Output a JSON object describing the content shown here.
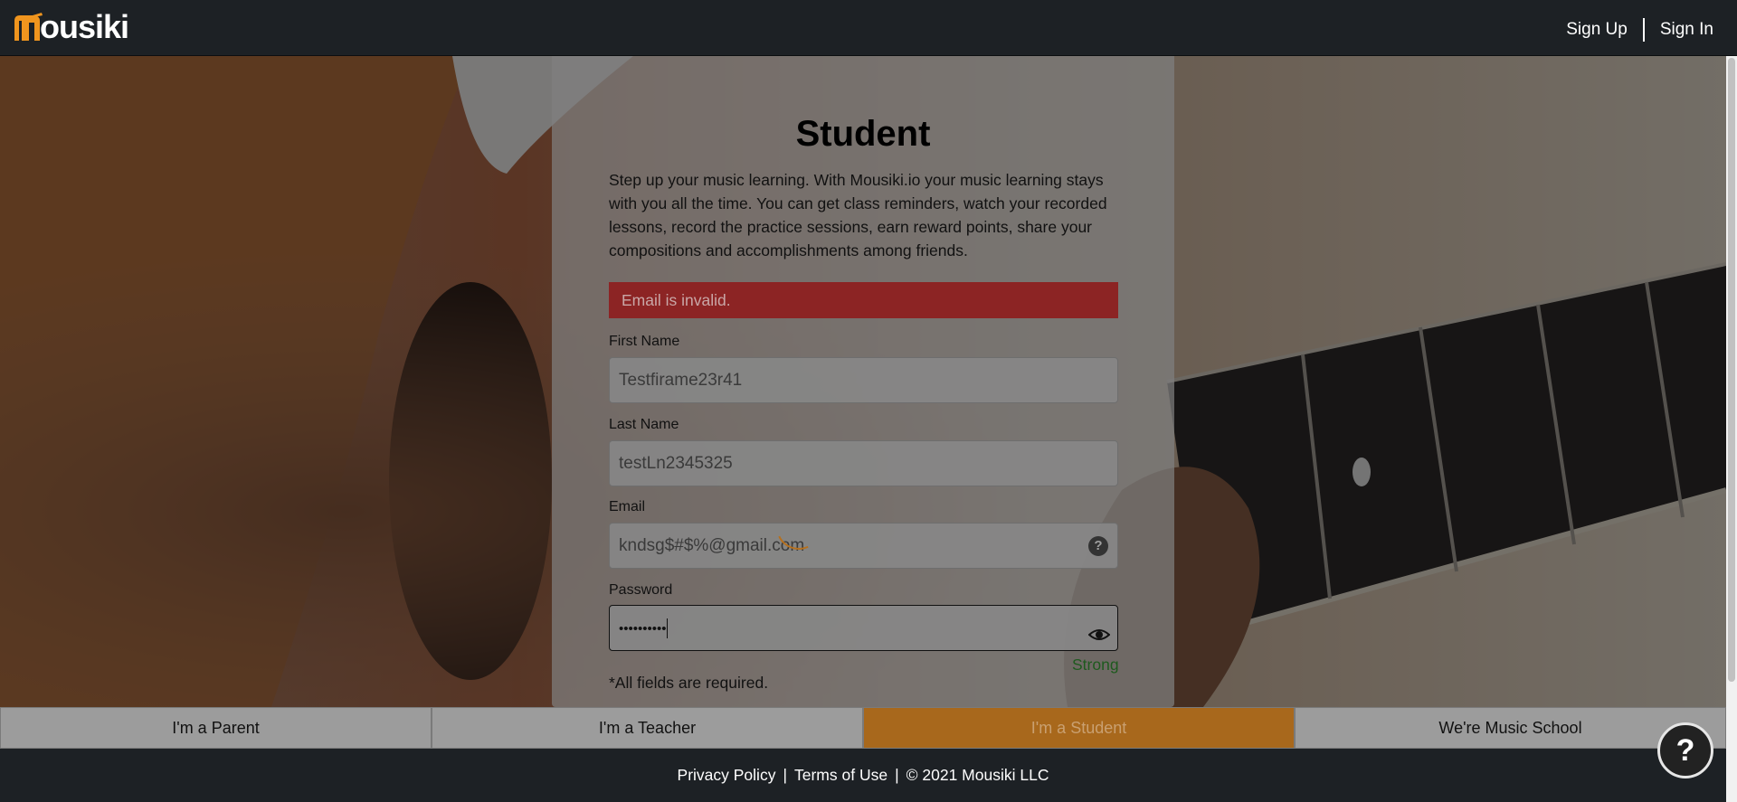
{
  "header": {
    "logo_text": "ousiki",
    "brand_color": "#f0951e",
    "sign_up": "Sign Up",
    "sign_in": "Sign In"
  },
  "form": {
    "title": "Student",
    "description": "Step up your music learning. With Mousiki.io your music learning stays with you all the time. You can get class reminders, watch your recorded lessons, record the practice sessions, earn reward points, share your compositions and accomplishments among friends.",
    "alert": "Email is invalid.",
    "first_name_label": "First Name",
    "first_name_value": "Testfirame23r41",
    "last_name_label": "Last Name",
    "last_name_value": "testLn2345325",
    "email_label": "Email",
    "email_value": "kndsg$#$%@gmail.com",
    "password_label": "Password",
    "password_value": "••••••••••",
    "password_strength": "Strong",
    "required_note": "*All fields are required."
  },
  "roles": {
    "parent": "I'm a Parent",
    "teacher": "I'm a Teacher",
    "student": "I'm a Student",
    "school": "We're Music School"
  },
  "footer": {
    "privacy": "Privacy Policy",
    "terms": "Terms of Use",
    "copyright": "© 2021 Mousiki LLC",
    "separator": "|"
  },
  "help_button": "?"
}
